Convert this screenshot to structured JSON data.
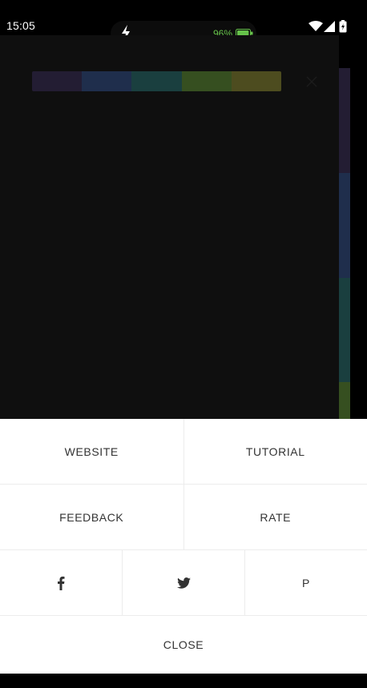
{
  "status_bar": {
    "time": "15:05",
    "battery_percent": "96%",
    "battery_level": 0.96
  },
  "colors": {
    "battery_green": "#66c24a",
    "sheet_background": "#ffffff",
    "sheet_text": "#333333",
    "palette": [
      "#231d33",
      "#1f2e4c",
      "#1a3f3f",
      "#364f20",
      "#4d4c1f"
    ]
  },
  "menu": {
    "website_label": "WEBSITE",
    "tutorial_label": "TUTORIAL",
    "feedback_label": "FEEDBACK",
    "rate_label": "RATE",
    "social": {
      "facebook_icon": "facebook-icon",
      "twitter_icon": "twitter-icon",
      "pinterest_label": "P"
    },
    "close_label": "CLOSE"
  }
}
